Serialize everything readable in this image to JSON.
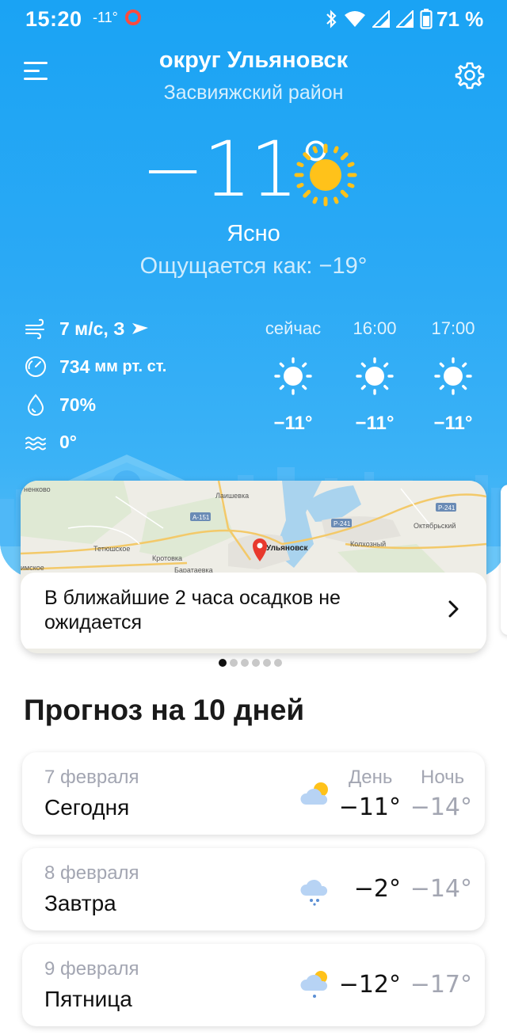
{
  "status_bar": {
    "time": "15:20",
    "temp": "-11°",
    "battery": "71 %"
  },
  "location": {
    "title": "округ Ульяновск",
    "subtitle": "Засвияжский район"
  },
  "current": {
    "temperature": "−11°",
    "condition": "Ясно",
    "feels_like": "Ощущается как: −19°",
    "icon": "sun-icon"
  },
  "details": {
    "wind_value": "7 м/с, З",
    "pressure_value": "734",
    "pressure_unit": "мм рт. ст.",
    "humidity": "70%",
    "water_temp": "0°"
  },
  "hourly": [
    {
      "label": "сейчас",
      "temp": "−11°",
      "icon": "sun-icon"
    },
    {
      "label": "16:00",
      "temp": "−11°",
      "icon": "sun-icon"
    },
    {
      "label": "17:00",
      "temp": "−11°",
      "icon": "sun-icon"
    }
  ],
  "map": {
    "places": [
      "Ульяновск",
      "Лаишевка",
      "Тетюшское",
      "Кротовка",
      "Баратаевка",
      "Колхозный",
      "Октябрьский",
      "ненково",
      "имское"
    ],
    "roads": [
      "A-151",
      "P-241",
      "P-241"
    ],
    "message": "В ближайшие 2 часа осадков не ожидается"
  },
  "carousel": {
    "pages": 6,
    "active": 0
  },
  "forecast": {
    "title": "Прогноз на 10 дней",
    "day_label": "День",
    "night_label": "Ночь",
    "days": [
      {
        "date": "7 февраля",
        "name": "Сегодня",
        "day": "−11°",
        "night": "−14°",
        "icon": "partly-cloudy-icon"
      },
      {
        "date": "8 февраля",
        "name": "Завтра",
        "day": "−2°",
        "night": "−14°",
        "icon": "cloud-snow-icon"
      },
      {
        "date": "9 февраля",
        "name": "Пятница",
        "day": "−12°",
        "night": "−17°",
        "icon": "partly-cloudy-snow-icon"
      }
    ]
  },
  "colors": {
    "accent": "#1aa3f4",
    "sun": "#ffc21a",
    "muted": "#a3a6b2"
  }
}
